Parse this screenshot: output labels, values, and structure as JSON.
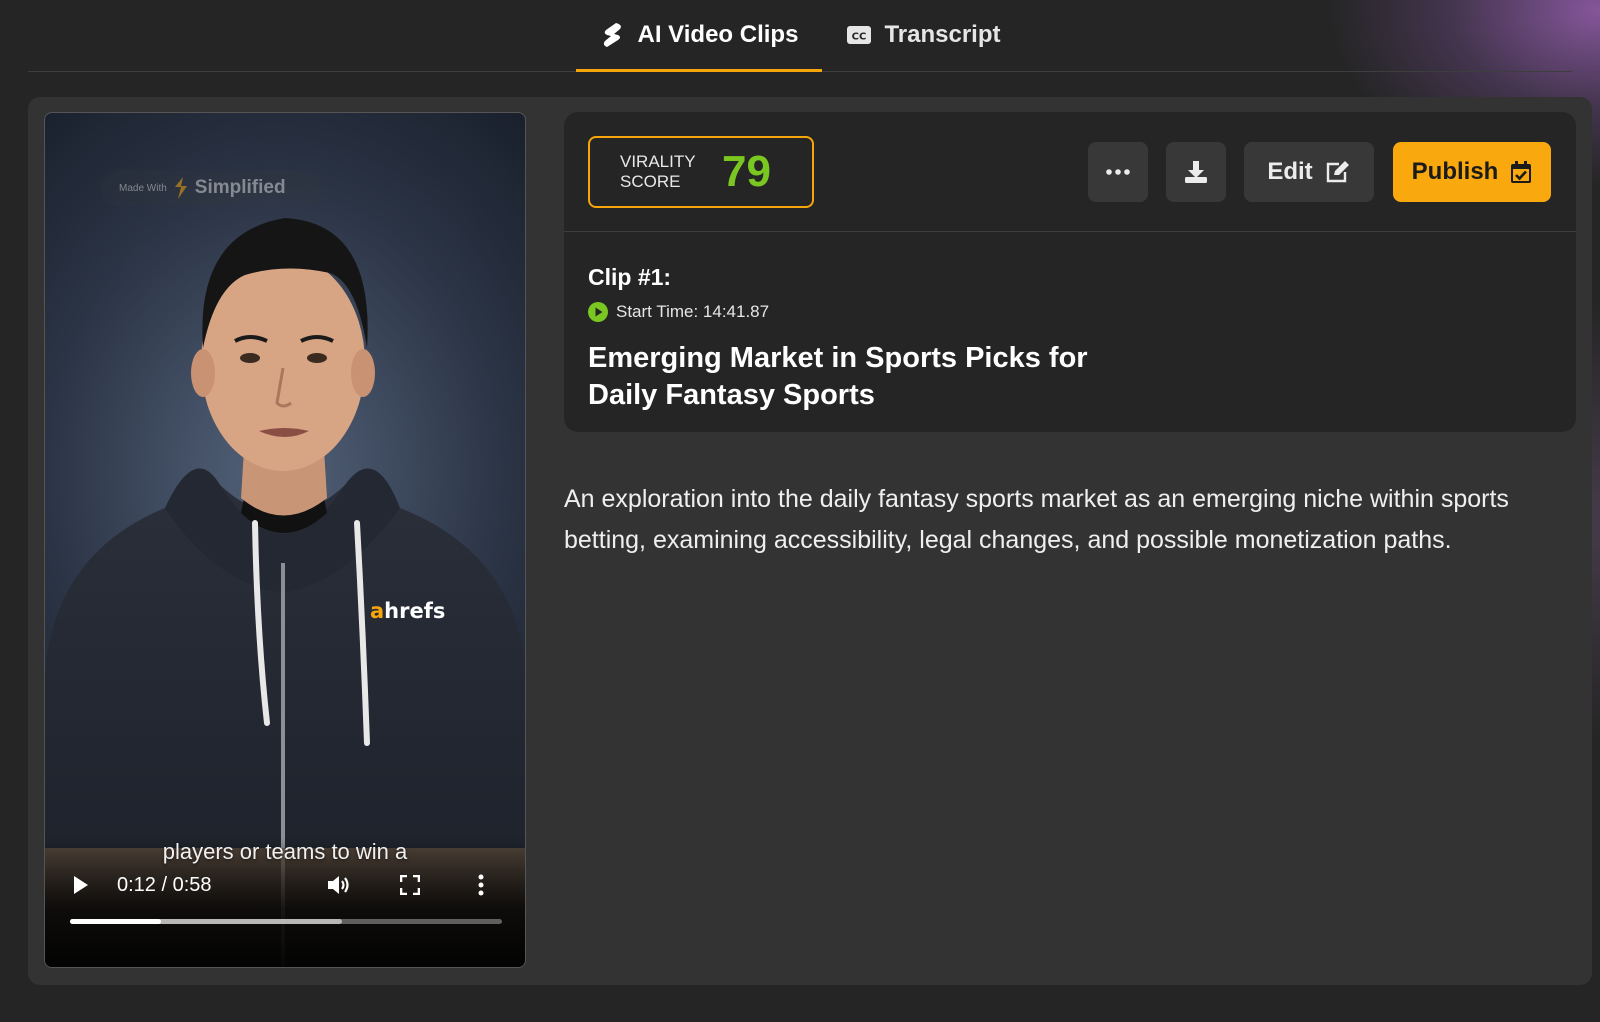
{
  "tabs": [
    {
      "label": "AI Video Clips",
      "icon": "clips-icon",
      "active": true
    },
    {
      "label": "Transcript",
      "icon": "cc-icon",
      "active": false
    }
  ],
  "video": {
    "watermark_prefix": "Made With",
    "watermark_brand": "Simplified",
    "shirt_logo": "ahrefs",
    "caption": "players or teams to win a",
    "time": "0:12 / 0:58",
    "played_fraction": 0.21,
    "buffered_fraction": 0.63
  },
  "clip": {
    "virality_label": "VIRALITY SCORE",
    "virality_score": "79",
    "number_label": "Clip #1:",
    "start_time": "Start Time: 14:41.87",
    "title": "Emerging Market in Sports Picks for Daily Fantasy Sports",
    "description": "An exploration into the daily fantasy sports market as an emerging niche within sports betting, examining accessibility, legal changes, and possible monetization paths."
  },
  "actions": {
    "edit_label": "Edit",
    "publish_label": "Publish"
  },
  "colors": {
    "accent": "#f6a60a",
    "score": "#79c720",
    "background": "#252525",
    "card": "#333333"
  }
}
